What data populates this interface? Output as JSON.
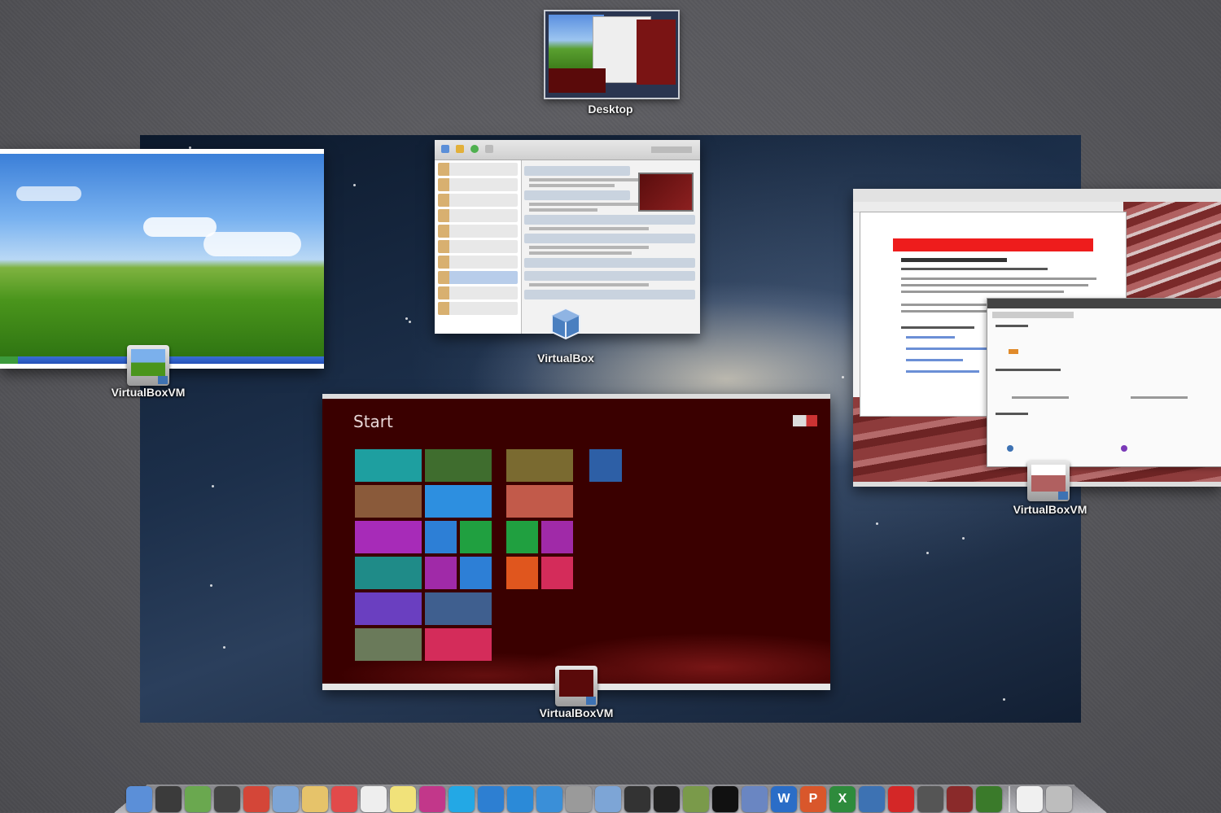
{
  "desktop": {
    "label": "Desktop"
  },
  "windows": {
    "xp": {
      "app_label": "VirtualBoxVM"
    },
    "vbox_manager": {
      "app_label": "VirtualBox"
    },
    "windows8": {
      "app_label": "VirtualBoxVM",
      "start_text": "Start"
    },
    "oracle_linux": {
      "app_label": "VirtualBoxVM"
    }
  },
  "dock": {
    "items": [
      {
        "icon": "finder-icon",
        "color": "#5b8fd8"
      },
      {
        "icon": "dashboard-icon",
        "color": "#3b3b3b"
      },
      {
        "icon": "automator-icon",
        "color": "#6aa84f"
      },
      {
        "icon": "photo-booth-icon",
        "color": "#444444"
      },
      {
        "icon": "chrome-icon",
        "color": "#d44638"
      },
      {
        "icon": "preview-icon",
        "color": "#7da5d6"
      },
      {
        "icon": "notes-icon",
        "color": "#e6c36a"
      },
      {
        "icon": "calendar-icon",
        "color": "#e24a4a"
      },
      {
        "icon": "textedit-icon",
        "color": "#eeeeee"
      },
      {
        "icon": "stickies-icon",
        "color": "#f1e27a"
      },
      {
        "icon": "gem-icon",
        "color": "#c2378a"
      },
      {
        "icon": "skype-icon",
        "color": "#23a8e5"
      },
      {
        "icon": "app-store-icon",
        "color": "#2d7fd2"
      },
      {
        "icon": "twitter-icon",
        "color": "#2b8ad8"
      },
      {
        "icon": "safari-icon",
        "color": "#3a8fd8"
      },
      {
        "icon": "keychain-icon",
        "color": "#9a9a9a"
      },
      {
        "icon": "system-info-icon",
        "color": "#7da5d6"
      },
      {
        "icon": "activity-monitor-icon",
        "color": "#333333"
      },
      {
        "icon": "console-icon",
        "color": "#222222"
      },
      {
        "icon": "grapher-icon",
        "color": "#7a9a4a"
      },
      {
        "icon": "terminal-icon",
        "color": "#111111"
      },
      {
        "icon": "xcode-icon",
        "color": "#6a86c2"
      },
      {
        "icon": "word-icon",
        "color": "#2a6dc7",
        "glyph": "W"
      },
      {
        "icon": "powerpoint-icon",
        "color": "#d9572b",
        "glyph": "P"
      },
      {
        "icon": "excel-icon",
        "color": "#2e8b3c",
        "glyph": "X"
      },
      {
        "icon": "virtualbox-icon",
        "color": "#3d72b3"
      },
      {
        "icon": "oracle-icon",
        "color": "#d42727"
      },
      {
        "icon": "vm-thumb-icon",
        "color": "#555555"
      },
      {
        "icon": "vm-thumb-icon-2",
        "color": "#8a2a2a"
      },
      {
        "icon": "vm-thumb-icon-3",
        "color": "#3a7a2a"
      },
      {
        "icon": "document-icon",
        "color": "#f0f0f0"
      },
      {
        "icon": "trash-icon",
        "color": "#bdbdbd"
      }
    ]
  },
  "colors": {
    "accent_red": "#ee1c1c",
    "w8_bg": "#3a0000"
  }
}
